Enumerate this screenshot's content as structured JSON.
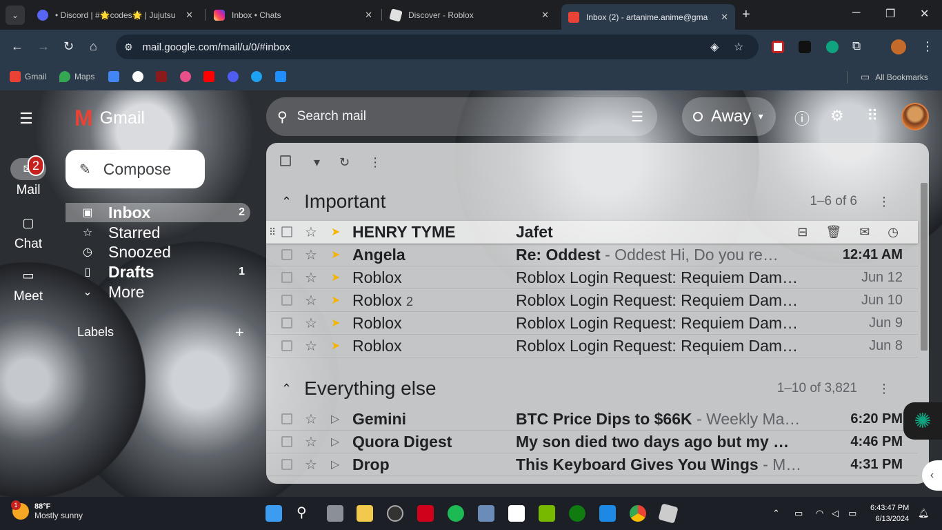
{
  "browser": {
    "tabs": [
      {
        "title": "• Discord | #🌟codes🌟 | Jujutsu",
        "icon": "discord-icon",
        "color": "#5865f2"
      },
      {
        "title": "Inbox • Chats",
        "icon": "instagram-icon",
        "color": "#d6249f"
      },
      {
        "title": "Discover - Roblox",
        "icon": "roblox-icon",
        "color": "#e0e0e0"
      },
      {
        "title": "Inbox (2) - artanime.anime@gma",
        "icon": "gmail-icon",
        "color": "#ea4335"
      }
    ],
    "url": "mail.google.com/mail/u/0/#inbox",
    "bookmarks": [
      {
        "label": "Gmail",
        "icon": "gmail-icon",
        "color": "#ea4335"
      },
      {
        "label": "Maps",
        "icon": "maps-icon",
        "color": "#34a853"
      }
    ],
    "all_bookmarks": "All Bookmarks"
  },
  "gmail": {
    "brand": "Gmail",
    "compose": "Compose",
    "rail": [
      {
        "label": "Mail",
        "badge": "2"
      },
      {
        "label": "Chat"
      },
      {
        "label": "Meet"
      }
    ],
    "folders": [
      {
        "label": "Inbox",
        "count": "2"
      },
      {
        "label": "Starred",
        "count": ""
      },
      {
        "label": "Snoozed",
        "count": ""
      },
      {
        "label": "Drafts",
        "count": "1"
      },
      {
        "label": "More",
        "count": ""
      }
    ],
    "labels_heading": "Labels",
    "search_placeholder": "Search mail",
    "status": "Away",
    "sections": [
      {
        "title": "Important",
        "range": "1–6 of 6",
        "rows": [
          {
            "sender": "HENRY TYME",
            "count": "",
            "subject": "Jafet",
            "snippet": "",
            "date": "",
            "unread": true
          },
          {
            "sender": "Angela",
            "count": "",
            "subject": "Re: Oddest",
            "snippet": " - Oddest Hi, Do you re…",
            "date": "12:41 AM",
            "unread": true
          },
          {
            "sender": "Roblox",
            "count": "",
            "subject": "Roblox Login Request: Requiem  Dam…",
            "snippet": "",
            "date": "Jun 12",
            "unread": false
          },
          {
            "sender": "Roblox",
            "count": "2",
            "subject": "Roblox Login Request: Requiem  Dam…",
            "snippet": "",
            "date": "Jun 10",
            "unread": false
          },
          {
            "sender": "Roblox",
            "count": "",
            "subject": "Roblox Login Request: Requiem  Dam…",
            "snippet": "",
            "date": "Jun 9",
            "unread": false
          },
          {
            "sender": "Roblox",
            "count": "",
            "subject": "Roblox Login Request: Requiem  Dam…",
            "snippet": "",
            "date": "Jun 8",
            "unread": false
          }
        ]
      },
      {
        "title": "Everything else",
        "range": "1–10 of 3,821",
        "rows": [
          {
            "sender": "Gemini",
            "subject": "BTC Price Dips to $66K",
            "snippet": " - Weekly Ma…",
            "date": "6:20 PM",
            "unread": true
          },
          {
            "sender": "Quora Digest",
            "subject": "My son died two days ago but my …",
            "snippet": "",
            "date": "4:46 PM",
            "unread": true
          },
          {
            "sender": "Drop",
            "subject": "This Keyboard Gives You Wings",
            "snippet": " - M…",
            "date": "4:31 PM",
            "unread": true
          }
        ]
      }
    ]
  },
  "taskbar": {
    "temperature": "88°F",
    "condition": "Mostly sunny",
    "weather_badge": "1",
    "time": "6:43:47 PM",
    "date": "6/13/2024"
  }
}
